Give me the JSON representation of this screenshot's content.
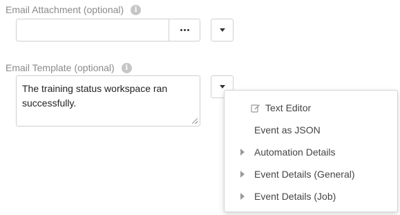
{
  "attachment": {
    "label": "Email Attachment (optional)",
    "info_icon": "i",
    "value": "",
    "browse_icon": "ellipsis-icon"
  },
  "template": {
    "label": "Email Template (optional)",
    "info_icon": "i",
    "value": "The training status workspace ran successfully."
  },
  "menu": {
    "items": [
      {
        "label": "Text Editor",
        "icon": "edit-icon"
      },
      {
        "label": "Event as JSON"
      },
      {
        "label": "Automation Details",
        "icon": "caret-right-icon"
      },
      {
        "label": "Event Details (General)",
        "icon": "caret-right-icon"
      },
      {
        "label": "Event Details (Job)",
        "icon": "caret-right-icon"
      }
    ]
  },
  "colors": {
    "label": "#8a8a8a",
    "border": "#cfcfcf",
    "info_icon": "#c6c6c6",
    "menu_text": "#444444"
  }
}
